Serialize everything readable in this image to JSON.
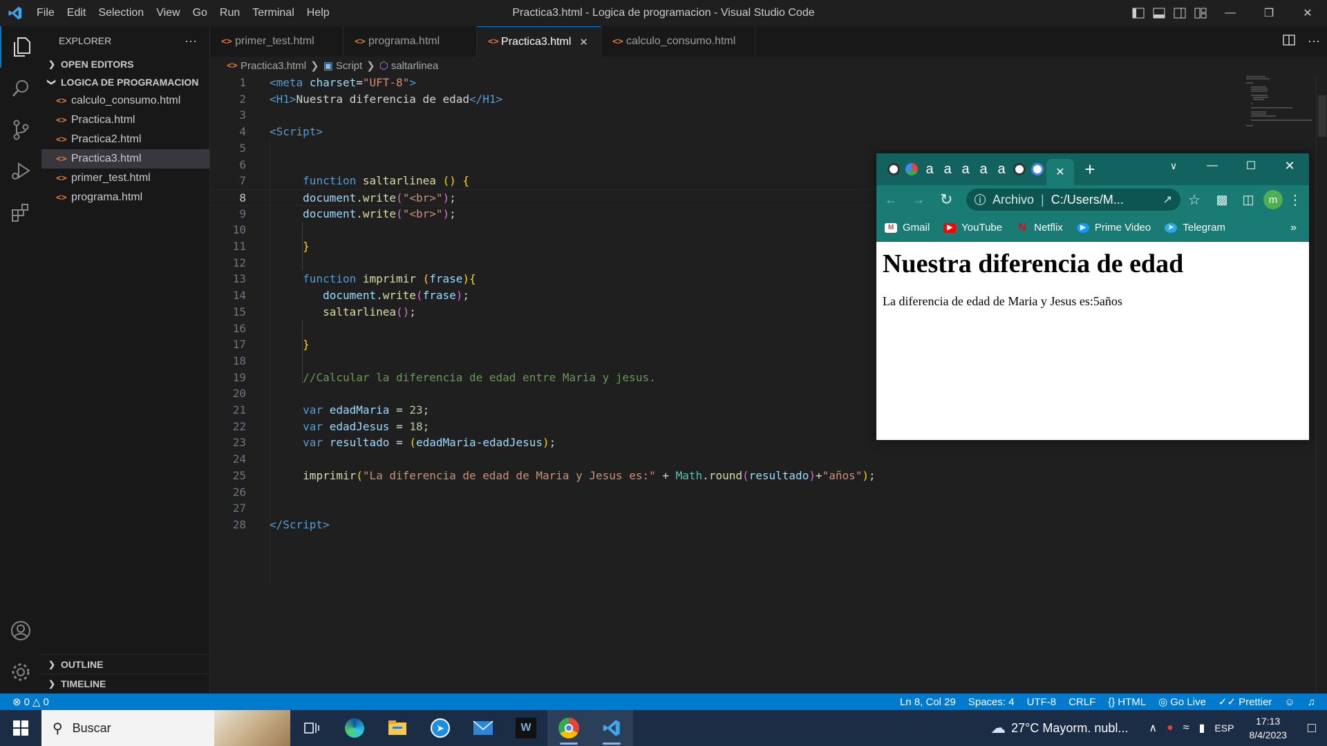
{
  "window": {
    "title": "Practica3.html - Logica de programacion - Visual Studio Code"
  },
  "menu": [
    "File",
    "Edit",
    "Selection",
    "View",
    "Go",
    "Run",
    "Terminal",
    "Help"
  ],
  "sidebar": {
    "explorer_label": "EXPLORER",
    "more_label": "···",
    "open_editors": "OPEN EDITORS",
    "folder": "LOGICA DE PROGRAMACION",
    "files": [
      "calculo_consumo.html",
      "Practica.html",
      "Practica2.html",
      "Practica3.html",
      "primer_test.html",
      "programa.html"
    ],
    "active_file_index": 3,
    "outline": "OUTLINE",
    "timeline": "TIMELINE"
  },
  "tabs": [
    {
      "label": "primer_test.html",
      "active": false
    },
    {
      "label": "programa.html",
      "active": false
    },
    {
      "label": "Practica3.html",
      "active": true
    },
    {
      "label": "calculo_consumo.html",
      "active": false
    }
  ],
  "breadcrumb": [
    "Practica3.html",
    "Script",
    "saltarlinea"
  ],
  "editor": {
    "current_line": 8,
    "line_count": 28
  },
  "statusbar": {
    "errors": "0",
    "warnings": "0",
    "position": "Ln 8, Col 29",
    "spaces": "Spaces: 4",
    "encoding": "UTF-8",
    "eol": "CRLF",
    "language": "HTML",
    "golive": "Go Live",
    "prettier": "Prettier"
  },
  "browser": {
    "tab_letter": "a",
    "address_prefix": "Archivo",
    "address": "C:/Users/M...",
    "profile_initial": "m",
    "bookmarks": [
      "Gmail",
      "YouTube",
      "Netflix",
      "Prime Video",
      "Telegram"
    ],
    "more": "»",
    "page_heading": "Nuestra diferencia de edad",
    "page_text": "La diferencia de edad de Maria y Jesus es:5años"
  },
  "taskbar": {
    "search_placeholder": "Buscar",
    "weather": "27°C  Mayorm. nubl...",
    "language": "ESP",
    "time": "17:13",
    "date": "8/4/2023"
  }
}
